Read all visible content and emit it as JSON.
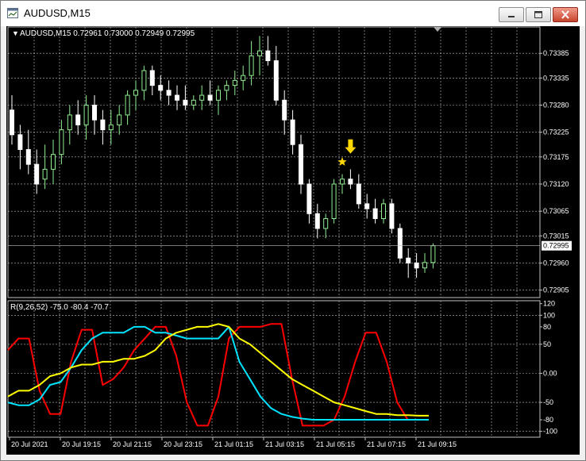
{
  "window": {
    "title": "AUDUSD,M15",
    "colors": {
      "background": "#000000",
      "grid": "#c0c0c0",
      "bull": "#90ee90",
      "bear": "#ffffff",
      "text": "#ffffff",
      "marker": "#ffd700"
    },
    "icons": [
      "chart-app-icon",
      "minimize-icon",
      "maximize-icon",
      "close-icon",
      "arrow-down-marker-icon",
      "star-marker-icon"
    ]
  },
  "header": {
    "triangle": "▼",
    "symbol_info": "AUDUSD,M15  0.72961 0.73000 0.72949 0.72995"
  },
  "price_axis": {
    "ticks": [
      "0.73385",
      "0.73335",
      "0.73280",
      "0.73225",
      "0.73175",
      "0.73120",
      "0.73065",
      "0.73015",
      "0.72960",
      "0.72905"
    ],
    "current_price": "0.72995"
  },
  "indicator": {
    "label": "R(9,26,52) -75.0 -80.4 -70.7",
    "ticks": [
      "120",
      "100",
      "80",
      "50",
      "0.00",
      "-50",
      "-80",
      "-100"
    ]
  },
  "time_axis": {
    "labels": [
      "20 Jul 2021",
      "20 Jul 19:15",
      "20 Jul 21:15",
      "20 Jul 23:15",
      "21 Jul 01:15",
      "21 Jul 03:15",
      "21 Jul 05:15",
      "21 Jul 07:15",
      "21 Jul 09:15"
    ]
  },
  "chart_data": [
    {
      "type": "candlestick",
      "title": "AUDUSD,M15",
      "ylim": [
        0.7289,
        0.7344
      ],
      "candles": [
        {
          "o": 0.7327,
          "h": 0.733,
          "l": 0.732,
          "c": 0.7322
        },
        {
          "o": 0.7322,
          "h": 0.7324,
          "l": 0.7315,
          "c": 0.7319
        },
        {
          "o": 0.7319,
          "h": 0.7323,
          "l": 0.7314,
          "c": 0.7316
        },
        {
          "o": 0.7316,
          "h": 0.7319,
          "l": 0.731,
          "c": 0.7312
        },
        {
          "o": 0.7313,
          "h": 0.732,
          "l": 0.7311,
          "c": 0.7315
        },
        {
          "o": 0.7315,
          "h": 0.7321,
          "l": 0.7312,
          "c": 0.7318
        },
        {
          "o": 0.7318,
          "h": 0.7325,
          "l": 0.7316,
          "c": 0.7323
        },
        {
          "o": 0.7323,
          "h": 0.7328,
          "l": 0.732,
          "c": 0.7326
        },
        {
          "o": 0.7326,
          "h": 0.7329,
          "l": 0.7322,
          "c": 0.7324
        },
        {
          "o": 0.7324,
          "h": 0.733,
          "l": 0.7321,
          "c": 0.7328
        },
        {
          "o": 0.7328,
          "h": 0.733,
          "l": 0.7322,
          "c": 0.7325
        },
        {
          "o": 0.7325,
          "h": 0.7327,
          "l": 0.732,
          "c": 0.7323
        },
        {
          "o": 0.7323,
          "h": 0.7327,
          "l": 0.732,
          "c": 0.7324
        },
        {
          "o": 0.7324,
          "h": 0.7328,
          "l": 0.7322,
          "c": 0.7326
        },
        {
          "o": 0.7326,
          "h": 0.7331,
          "l": 0.7324,
          "c": 0.733
        },
        {
          "o": 0.733,
          "h": 0.7333,
          "l": 0.7327,
          "c": 0.7331
        },
        {
          "o": 0.7331,
          "h": 0.7336,
          "l": 0.7329,
          "c": 0.7335
        },
        {
          "o": 0.7335,
          "h": 0.7336,
          "l": 0.733,
          "c": 0.7332
        },
        {
          "o": 0.7332,
          "h": 0.7334,
          "l": 0.7329,
          "c": 0.7331
        },
        {
          "o": 0.7331,
          "h": 0.7333,
          "l": 0.7328,
          "c": 0.733
        },
        {
          "o": 0.733,
          "h": 0.7332,
          "l": 0.7327,
          "c": 0.7329
        },
        {
          "o": 0.7329,
          "h": 0.7332,
          "l": 0.7327,
          "c": 0.7328
        },
        {
          "o": 0.7328,
          "h": 0.733,
          "l": 0.7327,
          "c": 0.7329
        },
        {
          "o": 0.7329,
          "h": 0.7332,
          "l": 0.7327,
          "c": 0.733
        },
        {
          "o": 0.733,
          "h": 0.7333,
          "l": 0.7328,
          "c": 0.7329
        },
        {
          "o": 0.7329,
          "h": 0.7332,
          "l": 0.7326,
          "c": 0.7331
        },
        {
          "o": 0.7331,
          "h": 0.7333,
          "l": 0.7329,
          "c": 0.7332
        },
        {
          "o": 0.7332,
          "h": 0.7335,
          "l": 0.733,
          "c": 0.7333
        },
        {
          "o": 0.7333,
          "h": 0.7336,
          "l": 0.7331,
          "c": 0.7334
        },
        {
          "o": 0.7334,
          "h": 0.7341,
          "l": 0.7332,
          "c": 0.7338
        },
        {
          "o": 0.7338,
          "h": 0.7342,
          "l": 0.7334,
          "c": 0.7339
        },
        {
          "o": 0.7339,
          "h": 0.7342,
          "l": 0.7336,
          "c": 0.7337
        },
        {
          "o": 0.7337,
          "h": 0.734,
          "l": 0.7328,
          "c": 0.7329
        },
        {
          "o": 0.7329,
          "h": 0.7331,
          "l": 0.7322,
          "c": 0.7325
        },
        {
          "o": 0.7325,
          "h": 0.7327,
          "l": 0.7318,
          "c": 0.732
        },
        {
          "o": 0.732,
          "h": 0.7322,
          "l": 0.731,
          "c": 0.7312
        },
        {
          "o": 0.7312,
          "h": 0.7313,
          "l": 0.7304,
          "c": 0.7306
        },
        {
          "o": 0.7306,
          "h": 0.7308,
          "l": 0.7301,
          "c": 0.7303
        },
        {
          "o": 0.7303,
          "h": 0.7306,
          "l": 0.7301,
          "c": 0.7305
        },
        {
          "o": 0.7305,
          "h": 0.7313,
          "l": 0.7304,
          "c": 0.7312
        },
        {
          "o": 0.7312,
          "h": 0.7314,
          "l": 0.731,
          "c": 0.7313
        },
        {
          "o": 0.7313,
          "h": 0.7315,
          "l": 0.7311,
          "c": 0.7312
        },
        {
          "o": 0.7312,
          "h": 0.7314,
          "l": 0.7307,
          "c": 0.7308
        },
        {
          "o": 0.7308,
          "h": 0.731,
          "l": 0.7305,
          "c": 0.7307
        },
        {
          "o": 0.7307,
          "h": 0.7309,
          "l": 0.7304,
          "c": 0.7305
        },
        {
          "o": 0.7305,
          "h": 0.7309,
          "l": 0.7304,
          "c": 0.7308
        },
        {
          "o": 0.7308,
          "h": 0.7309,
          "l": 0.7302,
          "c": 0.7303
        },
        {
          "o": 0.7303,
          "h": 0.7304,
          "l": 0.7296,
          "c": 0.7297
        },
        {
          "o": 0.7297,
          "h": 0.7299,
          "l": 0.7293,
          "c": 0.7296
        },
        {
          "o": 0.7296,
          "h": 0.7298,
          "l": 0.7293,
          "c": 0.7295
        },
        {
          "o": 0.7295,
          "h": 0.7298,
          "l": 0.7294,
          "c": 0.72961
        },
        {
          "o": 0.72961,
          "h": 0.73,
          "l": 0.72949,
          "c": 0.72995
        }
      ],
      "markers": [
        {
          "type": "arrow-down",
          "index": 41,
          "price": 0.73185
        },
        {
          "type": "star",
          "index": 40,
          "price": 0.73165
        }
      ]
    },
    {
      "type": "line",
      "title": "R(9,26,52)",
      "ylim": [
        -110,
        125
      ],
      "series": [
        {
          "name": "9",
          "color": "#ff0000",
          "values": [
            40,
            60,
            60,
            -30,
            -70,
            -70,
            20,
            75,
            75,
            -20,
            -10,
            10,
            40,
            60,
            80,
            80,
            30,
            -50,
            -90,
            -90,
            -40,
            60,
            80,
            80,
            80,
            85,
            85,
            -10,
            -90,
            -90,
            -90,
            -80,
            -40,
            20,
            70,
            70,
            20,
            -50,
            -80,
            -80,
            -80
          ]
        },
        {
          "name": "26",
          "color": "#00e5ff",
          "values": [
            -50,
            -55,
            -55,
            -45,
            -20,
            -15,
            10,
            40,
            60,
            70,
            70,
            70,
            80,
            80,
            70,
            70,
            65,
            60,
            60,
            60,
            60,
            80,
            20,
            -10,
            -40,
            -60,
            -70,
            -75,
            -78,
            -80,
            -80,
            -80,
            -80,
            -80,
            -80,
            -80,
            -80,
            -80,
            -80,
            -80,
            -80
          ]
        },
        {
          "name": "52",
          "color": "#ffff00",
          "values": [
            -40,
            -30,
            -30,
            -20,
            -5,
            0,
            10,
            15,
            15,
            20,
            20,
            25,
            25,
            30,
            40,
            60,
            70,
            75,
            80,
            80,
            85,
            80,
            60,
            50,
            35,
            20,
            5,
            -10,
            -20,
            -30,
            -40,
            -50,
            -55,
            -60,
            -65,
            -70,
            -70,
            -72,
            -72,
            -73,
            -73
          ]
        }
      ]
    }
  ]
}
